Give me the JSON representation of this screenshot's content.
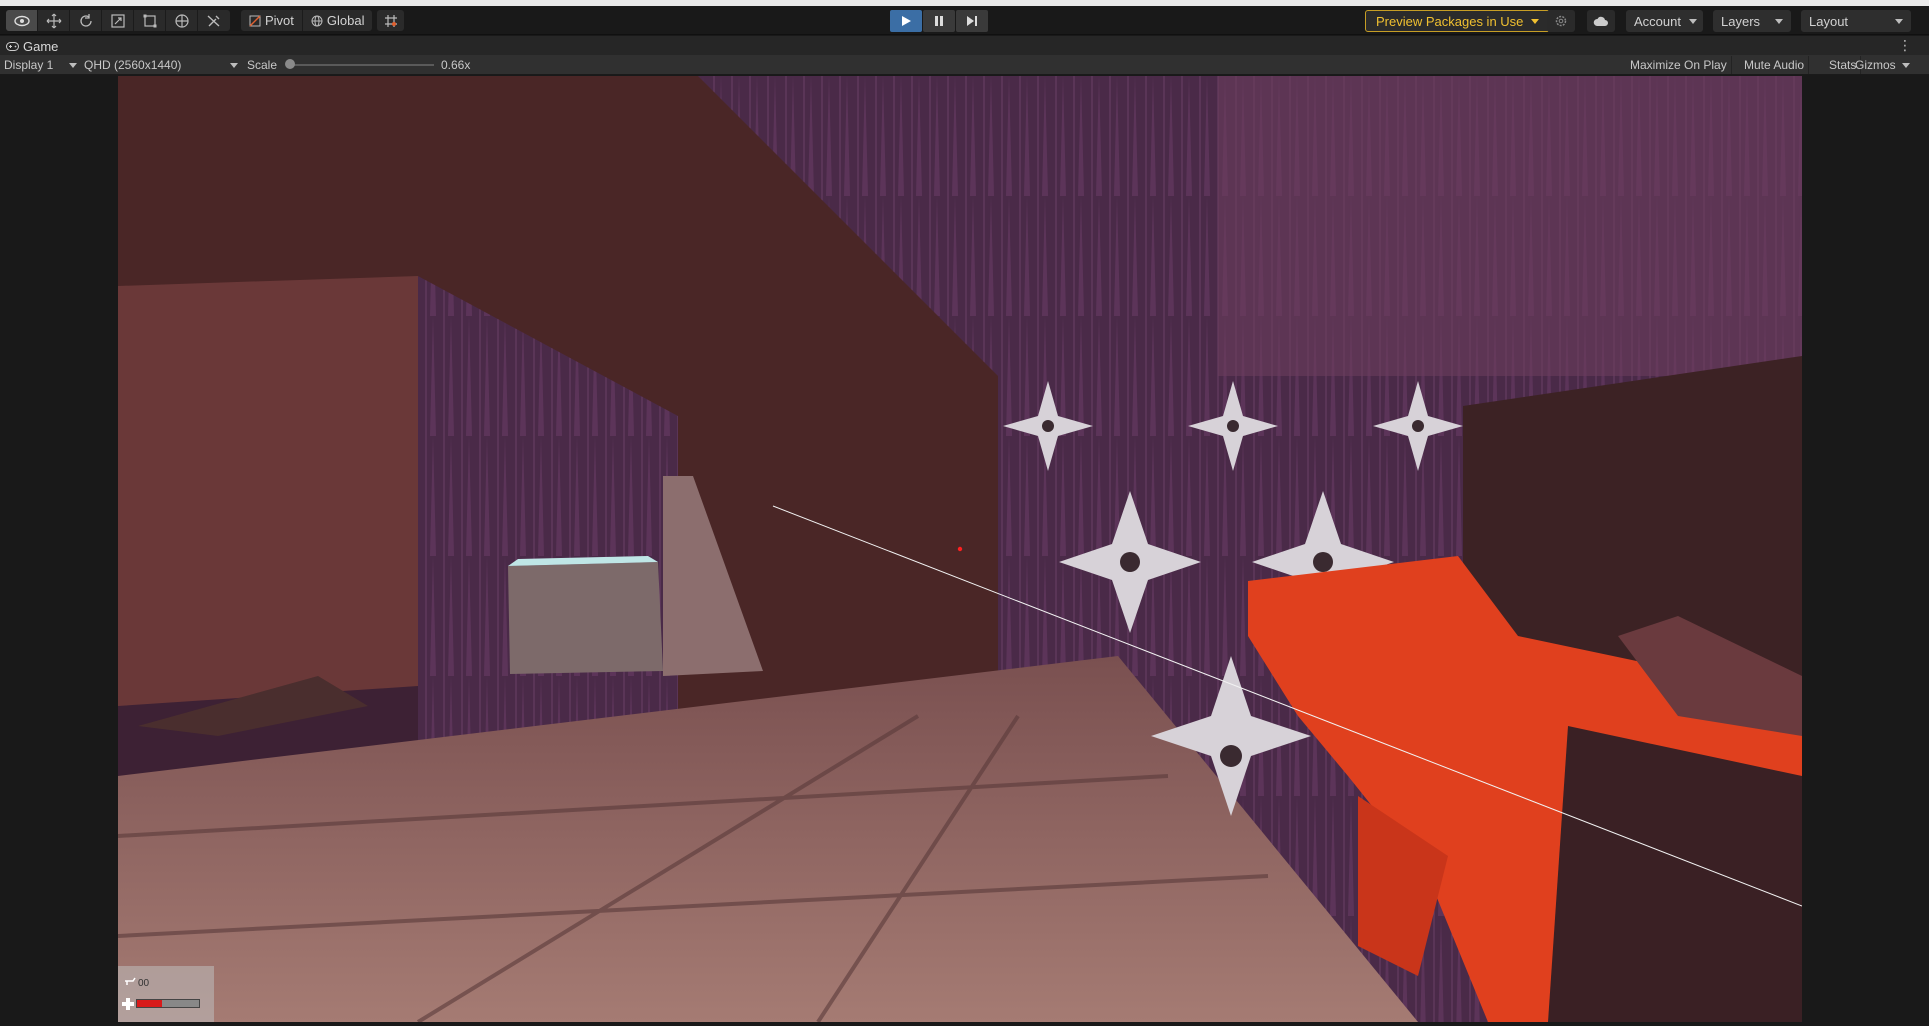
{
  "toolbar": {
    "tools": [
      {
        "icon": "view-tool-icon",
        "active": true
      },
      {
        "icon": "move-tool-icon",
        "active": false
      },
      {
        "icon": "rotate-tool-icon",
        "active": false
      },
      {
        "icon": "scale-tool-icon",
        "active": false
      },
      {
        "icon": "rect-tool-icon",
        "active": false
      },
      {
        "icon": "transform-tool-icon",
        "active": false
      },
      {
        "icon": "custom-tool-icon",
        "active": false
      }
    ],
    "pivot_label": "Pivot",
    "global_label": "Global",
    "preview_packages_label": "Preview Packages in Use",
    "account_label": "Account",
    "layers_label": "Layers",
    "layout_label": "Layout"
  },
  "tab": {
    "title": "Game"
  },
  "game_bar": {
    "display": "Display 1",
    "resolution": "QHD (2560x1440)",
    "scale_label": "Scale",
    "scale_value": "0.66x",
    "scale_fraction": 0.0,
    "maximize_label": "Maximize On Play",
    "mute_label": "Mute Audio",
    "stats_label": "Stats",
    "gizmos_label": "Gizmos"
  },
  "hud": {
    "ammo": "00",
    "health_fraction": 0.4
  },
  "colors": {
    "play_active": "#3b6ea5",
    "preview_border": "#c79e25",
    "health": "#d81a1a",
    "gun": "#e0401e",
    "backdrop": "#4a2a48"
  }
}
